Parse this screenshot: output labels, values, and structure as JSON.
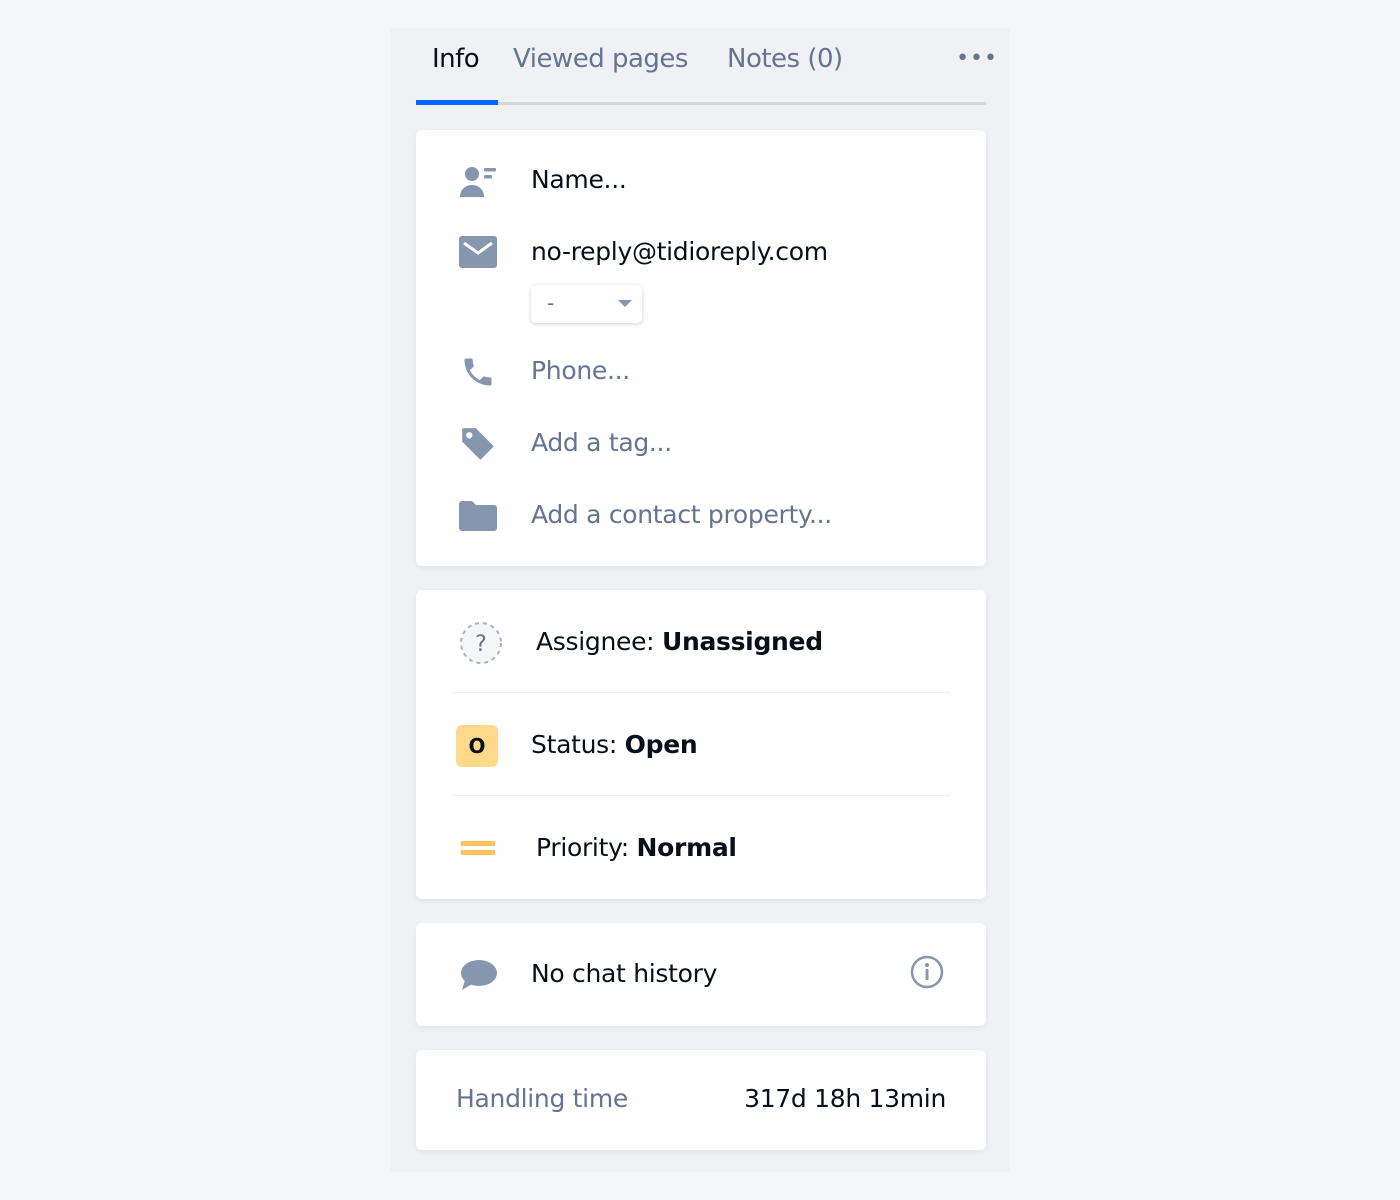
{
  "tabs": [
    {
      "label": "Info",
      "active": true
    },
    {
      "label": "Viewed pages"
    },
    {
      "label": "Notes (0)"
    }
  ],
  "more_label": "•••",
  "contact": {
    "name_placeholder": "Name...",
    "email": "no-reply@tidioreply.com",
    "email_select_value": "-",
    "phone_placeholder": "Phone...",
    "tag_placeholder": "Add a tag...",
    "property_placeholder": "Add a contact property..."
  },
  "conversation": {
    "assignee_label": "Assignee:",
    "assignee_value": "Unassigned",
    "status_label": "Status:",
    "status_value": "Open",
    "status_icon_char": "O",
    "priority_label": "Priority:",
    "priority_value": "Normal"
  },
  "history": {
    "text": "No chat history"
  },
  "handling": {
    "label": "Handling time",
    "value": "317d 18h 13min"
  },
  "colors": {
    "accent": "#0566ff",
    "icon": "#8796af",
    "status_bg": "#ffd98a",
    "priority": "#ffc35c"
  }
}
